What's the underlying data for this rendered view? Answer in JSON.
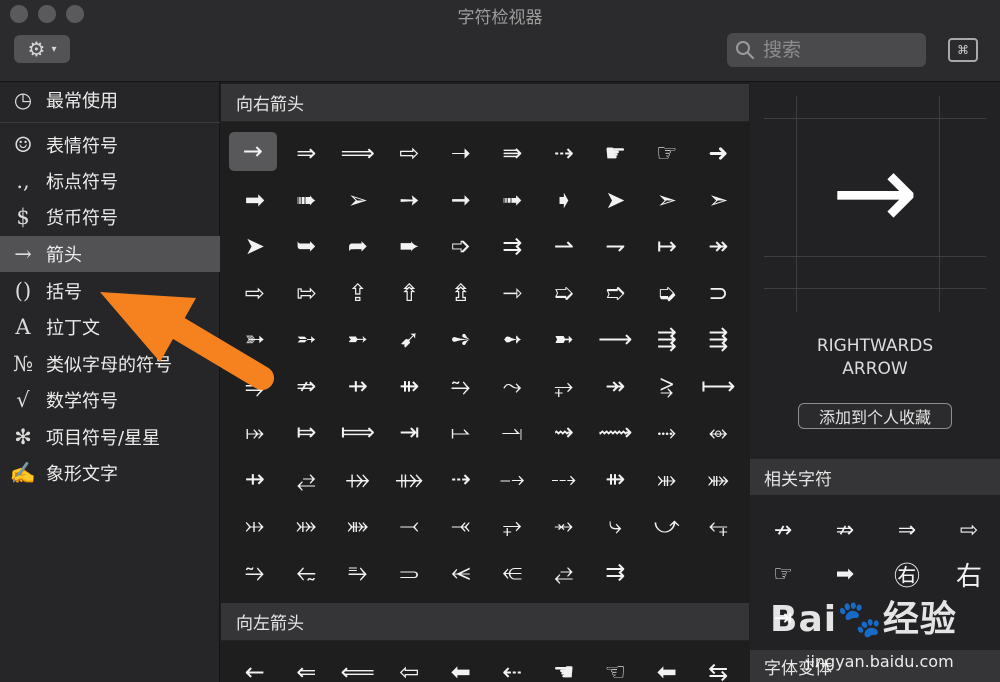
{
  "window": {
    "title": "字符检视器"
  },
  "toolbar": {
    "search_placeholder": "搜索",
    "kbd_glyph": "⌘"
  },
  "sidebar": {
    "items": [
      {
        "icon": "clock-icon",
        "glyph": "◷",
        "label": "最常使用"
      },
      {
        "icon": "emoji-icon",
        "glyph": "☺",
        "label": "表情符号"
      },
      {
        "icon": "punctuation-icon",
        "glyph": ".,",
        "label": "标点符号"
      },
      {
        "icon": "currency-icon",
        "glyph": "$",
        "label": "货币符号"
      },
      {
        "icon": "arrow-icon",
        "glyph": "→",
        "label": "箭头"
      },
      {
        "icon": "parentheses-icon",
        "glyph": "()",
        "label": "括号"
      },
      {
        "icon": "latin-icon",
        "glyph": "A",
        "label": "拉丁文"
      },
      {
        "icon": "numero-icon",
        "glyph": "№",
        "label": "类似字母的符号"
      },
      {
        "icon": "sqrt-icon",
        "glyph": "√",
        "label": "数学符号"
      },
      {
        "icon": "asterisk-icon",
        "glyph": "✻",
        "label": "项目符号/星星"
      },
      {
        "icon": "pictograph-icon",
        "glyph": "✍",
        "label": "象形文字"
      }
    ]
  },
  "main": {
    "section1_title": "向右箭头",
    "right_arrows": [
      "→",
      "⇒",
      "⟹",
      "⇨",
      "➝",
      "⇛",
      "⇢",
      "☛",
      "☞",
      "➜",
      "➡",
      "➠",
      "➢",
      "➙",
      "➞",
      "➟",
      "➧",
      "➤",
      "➣",
      "➣",
      "➤",
      "➥",
      "➦",
      "➨",
      "➩",
      "⇉",
      "⇀",
      "⇁",
      "↦",
      "↠",
      "⇨",
      "⇰",
      "⇪",
      "⇮",
      "⇯",
      "⇾",
      "➯",
      "➱",
      "➭",
      "⊃",
      "➳",
      "➵",
      "➸",
      "➹",
      "➺",
      "➻",
      "➼",
      "⟶",
      "⇶",
      "⇶",
      "⥤",
      "⇏",
      "⇸",
      "⇻",
      "⥲",
      "⤳",
      "⥅",
      "↠",
      "⥸",
      "⟼",
      "⤅",
      "⤇",
      "⟾",
      "⇥",
      "⥛",
      "⥓",
      "⇝",
      "⟿",
      "⤑",
      "⥈",
      "⇸",
      "⥄",
      "⤀",
      "⤁",
      "⇢",
      "⤍",
      "⤏",
      "⇻",
      "⤕",
      "⤘",
      "⤔",
      "⤗",
      "⤘",
      "⤙",
      "⤛",
      "⥅",
      "⥇",
      "⤷",
      "⤻",
      "⥆",
      "⥲",
      "⥳",
      "⥱",
      "⥰",
      "⥷",
      "⥺",
      "⥄",
      "⇉",
      "",
      ""
    ],
    "section2_title": "向左箭头",
    "left_arrows": [
      "←",
      "⇐",
      "⟸",
      "⇦",
      "⬅",
      "⇠",
      "☚",
      "☜",
      "⬅",
      "⇆"
    ]
  },
  "detail": {
    "glyph": "→",
    "name_line1": "RIGHTWARDS",
    "name_line2": "ARROW",
    "favorite_button": "添加到个人收藏",
    "related_title": "相关字符",
    "related": [
      "↛",
      "⇏",
      "⇒",
      "⇨",
      "☞",
      "➡",
      "㊨",
      "右",
      "⇥",
      "",
      "",
      ""
    ],
    "font_variants_title": "字体变体"
  },
  "watermark": {
    "brand": "Bai du 经验",
    "url": "jingyan.baidu.com"
  },
  "colors": {
    "annotation_arrow": "#F5821F",
    "selection": "#58585B"
  }
}
